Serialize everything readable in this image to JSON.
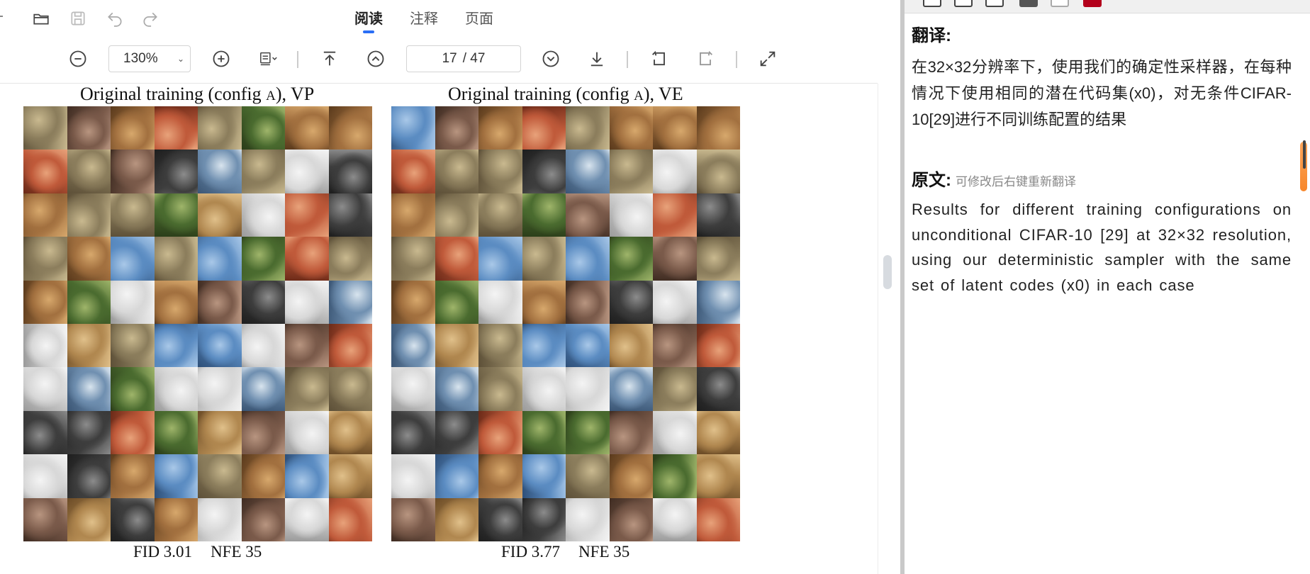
{
  "mode_tabs": [
    {
      "label": "阅读",
      "active": true
    },
    {
      "label": "注释",
      "active": false
    },
    {
      "label": "页面",
      "active": false
    }
  ],
  "toolbar": {
    "zoom_value": "130%",
    "page_current": "17",
    "page_total": "/ 47"
  },
  "document": {
    "panels": [
      {
        "title_pre": "Original training (config ",
        "title_sc": "A",
        "title_post": "), VP",
        "fid": "FID 3.01",
        "nfe": "NFE 35"
      },
      {
        "title_pre": "Original training (config ",
        "title_sc": "A",
        "title_post": "), VE",
        "fid": "FID 3.77",
        "nfe": "NFE 35"
      }
    ]
  },
  "translation": {
    "heading": "翻译:",
    "text": "在32×32分辨率下，使用我们的确定性采样器，在每种情况下使用相同的潜在代码集(x0)，对无条件CIFAR-10[29]进行不同训练配置的结果",
    "original_heading": "原文:",
    "original_hint": "可修改后右键重新翻译",
    "original_text": "Results for different training configurations on unconditional CIFAR-10 [29] at 32×32 resolution, using our deterministic sampler with the same set of latent codes (x0) in each case"
  },
  "colors": {
    "accent": "#2a6ef5",
    "scroll_accent": "#f7862a",
    "strip_red": "#b3001b"
  },
  "icons": {
    "titlebar": [
      "folder-open-icon",
      "save-icon",
      "undo-icon",
      "redo-icon"
    ],
    "toolbar": [
      "zoom-out-icon",
      "zoom-in-icon",
      "page-layout-icon",
      "first-page-icon",
      "prev-page-icon",
      "next-page-icon",
      "last-page-icon",
      "rotate-left-icon",
      "rotate-right-icon",
      "fullscreen-icon"
    ]
  }
}
